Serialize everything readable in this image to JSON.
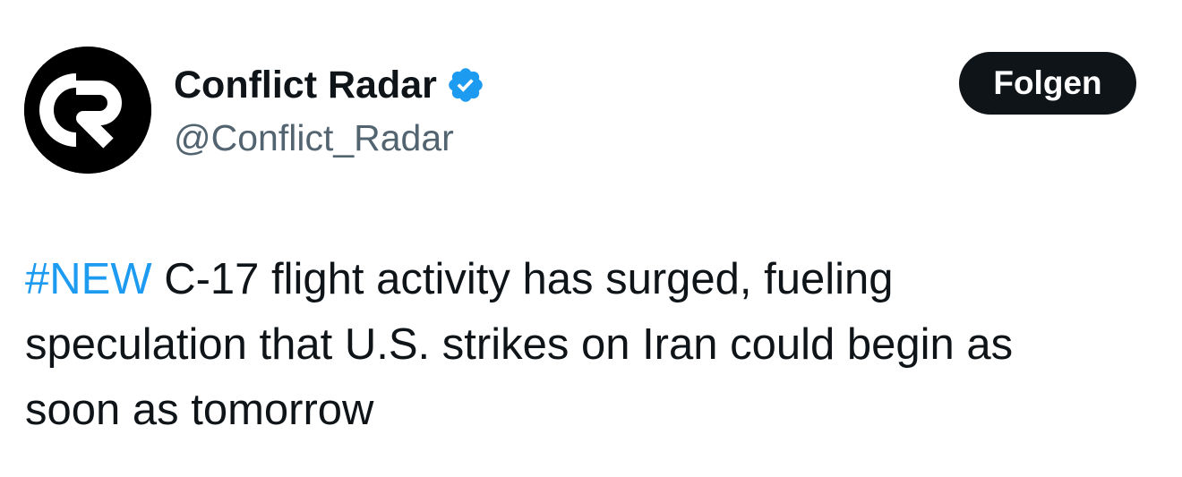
{
  "author": {
    "display_name": "Conflict Radar",
    "handle": "@Conflict_Radar",
    "verified": true,
    "avatar_icon": "conflict-radar-logo-icon",
    "verified_icon": "verified-badge-icon"
  },
  "follow_button": {
    "label": "Folgen"
  },
  "tweet": {
    "hashtag": "#NEW",
    "line1_rest": " C-17 flight activity has surged, fueling",
    "line2": "speculation that U.S. strikes on Iran could begin as",
    "line3": "soon as tomorrow"
  },
  "colors": {
    "text": "#0f1419",
    "secondary_text": "#536471",
    "link": "#1d9bf0",
    "verified_badge": "#1d9bf0",
    "button_bg": "#0f1419",
    "button_text": "#ffffff"
  }
}
